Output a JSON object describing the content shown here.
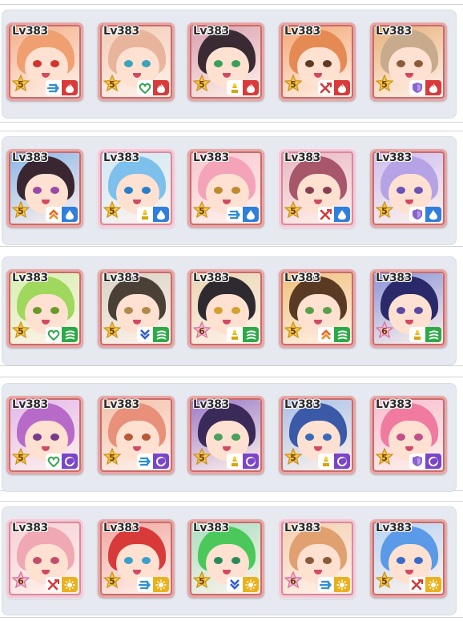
{
  "colors": {
    "fire": "#d93a3a",
    "water": "#2f7fdc",
    "wind": "#2daa48",
    "dark": "#7a45c9",
    "light": "#e9b21c"
  },
  "rows": [
    {
      "element": "fire",
      "cards": [
        {
          "level": "Lv383",
          "stars": "5",
          "role": "speed",
          "fancy": false,
          "hair": "#f0a070",
          "bg": "#f4b08c",
          "eye": "#d0342c"
        },
        {
          "level": "Lv383",
          "stars": "5",
          "role": "heal",
          "fancy": false,
          "hair": "#e8b49c",
          "bg": "#f3cbb6",
          "eye": "#3aa4b8"
        },
        {
          "level": "Lv383",
          "stars": "5",
          "role": "buff",
          "fancy": false,
          "hair": "#3a2a33",
          "bg": "#d9a0b0",
          "eye": "#38a05a"
        },
        {
          "level": "Lv383",
          "stars": "5",
          "role": "attack",
          "fancy": false,
          "hair": "#e68a54",
          "bg": "#f3a875",
          "eye": "#5e3a22"
        },
        {
          "level": "Lv383",
          "stars": "5",
          "role": "defense",
          "fancy": false,
          "hair": "#c7ab8c",
          "bg": "#e8b27a",
          "eye": "#8d5a3a"
        }
      ]
    },
    {
      "element": "water",
      "cards": [
        {
          "level": "Lv383",
          "stars": "5",
          "role": "boost",
          "fancy": false,
          "hair": "#3a2630",
          "bg": "#8ab6e8",
          "eye": "#9a4aa6"
        },
        {
          "level": "Lv383",
          "stars": "5",
          "role": "buff",
          "fancy": true,
          "hair": "#7ec0ec",
          "bg": "#cfe8f6",
          "eye": "#2a7fc8"
        },
        {
          "level": "Lv383",
          "stars": "5",
          "role": "speed",
          "fancy": false,
          "hair": "#f4a3b8",
          "bg": "#f7c6d0",
          "eye": "#c08a30"
        },
        {
          "level": "Lv383",
          "stars": "5",
          "role": "attack",
          "fancy": true,
          "hair": "#a8566a",
          "bg": "#e8b7c4",
          "eye": "#8a4050"
        },
        {
          "level": "Lv383",
          "stars": "5",
          "role": "defense",
          "fancy": false,
          "hair": "#b5a3e6",
          "bg": "#cdbff0",
          "eye": "#6a54b8"
        }
      ]
    },
    {
      "element": "wind",
      "cards": [
        {
          "level": "Lv383",
          "stars": "5",
          "role": "heal",
          "fancy": false,
          "hair": "#9fd85c",
          "bg": "#d6efb0",
          "eye": "#6a9a2a"
        },
        {
          "level": "Lv383",
          "stars": "5",
          "role": "shield",
          "fancy": false,
          "hair": "#4a4036",
          "bg": "#d9d2c4",
          "eye": "#b08a4a"
        },
        {
          "level": "Lv383",
          "stars": "6",
          "role": "buff",
          "fancy": false,
          "hair": "#2e2a30",
          "bg": "#e8d6b2",
          "eye": "#d4a030"
        },
        {
          "level": "Lv383",
          "stars": "5",
          "role": "boost",
          "fancy": false,
          "hair": "#5a3a22",
          "bg": "#f0c07a",
          "eye": "#5aa04a"
        },
        {
          "level": "Lv383",
          "stars": "6",
          "role": "buff",
          "fancy": false,
          "hair": "#2a2a6a",
          "bg": "#8a94d8",
          "eye": "#5a4aa0"
        }
      ]
    },
    {
      "element": "dark",
      "cards": [
        {
          "level": "Lv383",
          "stars": "5",
          "role": "heal",
          "fancy": false,
          "hair": "#b86ac8",
          "bg": "#e2b8ea",
          "eye": "#7a3a8a"
        },
        {
          "level": "Lv383",
          "stars": "5",
          "role": "speed",
          "fancy": false,
          "hair": "#e8907a",
          "bg": "#f3c0a8",
          "eye": "#b85a3a"
        },
        {
          "level": "Lv383",
          "stars": "5",
          "role": "buff",
          "fancy": false,
          "hair": "#3a2a5a",
          "bg": "#9a7ac8",
          "eye": "#4aa05a"
        },
        {
          "level": "Lv383",
          "stars": "5",
          "role": "buff",
          "fancy": false,
          "hair": "#3a5aa8",
          "bg": "#a8c0e8",
          "eye": "#3a6ab8"
        },
        {
          "level": "Lv383",
          "stars": "5",
          "role": "defense",
          "fancy": false,
          "hair": "#f07aa0",
          "bg": "#f7bcd0",
          "eye": "#c0508a"
        }
      ]
    },
    {
      "element": "light",
      "cards": [
        {
          "level": "Lv383",
          "stars": "6",
          "role": "attack",
          "fancy": true,
          "hair": "#f0a8b4",
          "bg": "#f6d0d6",
          "eye": "#c0506a"
        },
        {
          "level": "Lv383",
          "stars": "5",
          "role": "speed",
          "fancy": false,
          "hair": "#d83a3a",
          "bg": "#f0a8a0",
          "eye": "#3aa0c8"
        },
        {
          "level": "Lv383",
          "stars": "5",
          "role": "shield",
          "fancy": false,
          "hair": "#4ac85a",
          "bg": "#a8e0c0",
          "eye": "#2a8a5a"
        },
        {
          "level": "Lv383",
          "stars": "6",
          "role": "speed",
          "fancy": true,
          "hair": "#e0a070",
          "bg": "#f3d0b0",
          "eye": "#8a5a3a"
        },
        {
          "level": "Lv383",
          "stars": "5",
          "role": "attack",
          "fancy": false,
          "hair": "#5a9ae8",
          "bg": "#b8d4f4",
          "eye": "#3a6ac8"
        }
      ]
    }
  ]
}
